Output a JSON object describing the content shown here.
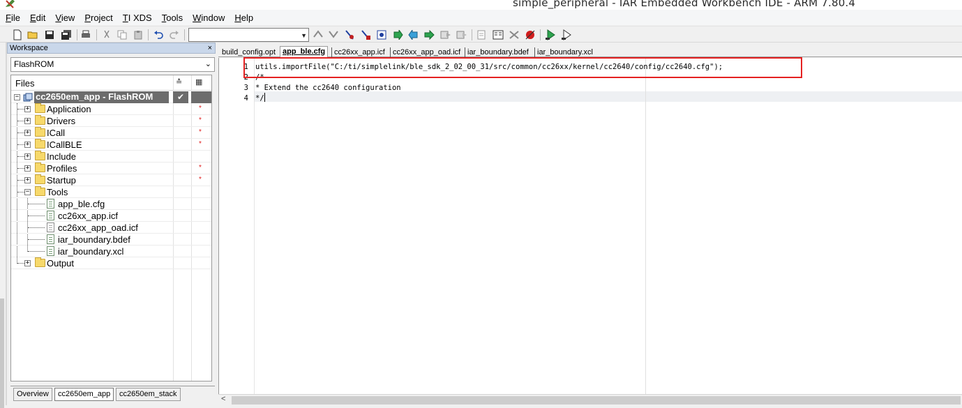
{
  "window": {
    "title": "simple_peripheral - IAR Embedded Workbench IDE - ARM 7.80.4"
  },
  "menu": [
    {
      "key": "F",
      "rest": "ile"
    },
    {
      "key": "E",
      "rest": "dit"
    },
    {
      "key": "V",
      "rest": "iew"
    },
    {
      "key": "P",
      "rest": "roject"
    },
    {
      "key": "T",
      "rest": "I XDS"
    },
    {
      "key": "T",
      "rest": "ools"
    },
    {
      "key": "W",
      "rest": "indow"
    },
    {
      "key": "H",
      "rest": "elp"
    }
  ],
  "toolbar": {
    "search_value": ""
  },
  "workspace": {
    "title": "Workspace",
    "close": "×",
    "configuration": "FlashROM",
    "files_header": "Files",
    "root": {
      "label": "cc2650em_app - FlashROM",
      "check": "✔"
    },
    "groups": [
      {
        "label": "Application",
        "modified": "*"
      },
      {
        "label": "Drivers",
        "modified": "*"
      },
      {
        "label": "ICall",
        "modified": "*"
      },
      {
        "label": "ICallBLE",
        "modified": "*"
      },
      {
        "label": "Include",
        "modified": ""
      },
      {
        "label": "Profiles",
        "modified": "*"
      },
      {
        "label": "Startup",
        "modified": "*"
      },
      {
        "label": "Tools",
        "modified": ""
      }
    ],
    "tools_files": [
      "app_ble.cfg",
      "cc26xx_app.icf",
      "cc26xx_app_oad.icf",
      "iar_boundary.bdef",
      "iar_boundary.xcl"
    ],
    "output": {
      "label": "Output"
    },
    "tabs": [
      "Overview",
      "cc2650em_app",
      "cc2650em_stack"
    ]
  },
  "editor": {
    "tabs": [
      "build_config.opt",
      "app_ble.cfg",
      "cc26xx_app.icf",
      "cc26xx_app_oad.icf",
      "iar_boundary.bdef",
      "iar_boundary.xcl"
    ],
    "active_tab": "app_ble.cfg",
    "line_numbers": [
      "1",
      "2",
      "3",
      "4"
    ],
    "lines": [
      "utils.importFile(\"C:/ti/simplelink/ble_sdk_2_02_00_31/src/common/cc26xx/kernel/cc2640/config/cc2640.cfg\");",
      "/*",
      "* Extend the cc2640 configuration",
      "*/"
    ]
  }
}
